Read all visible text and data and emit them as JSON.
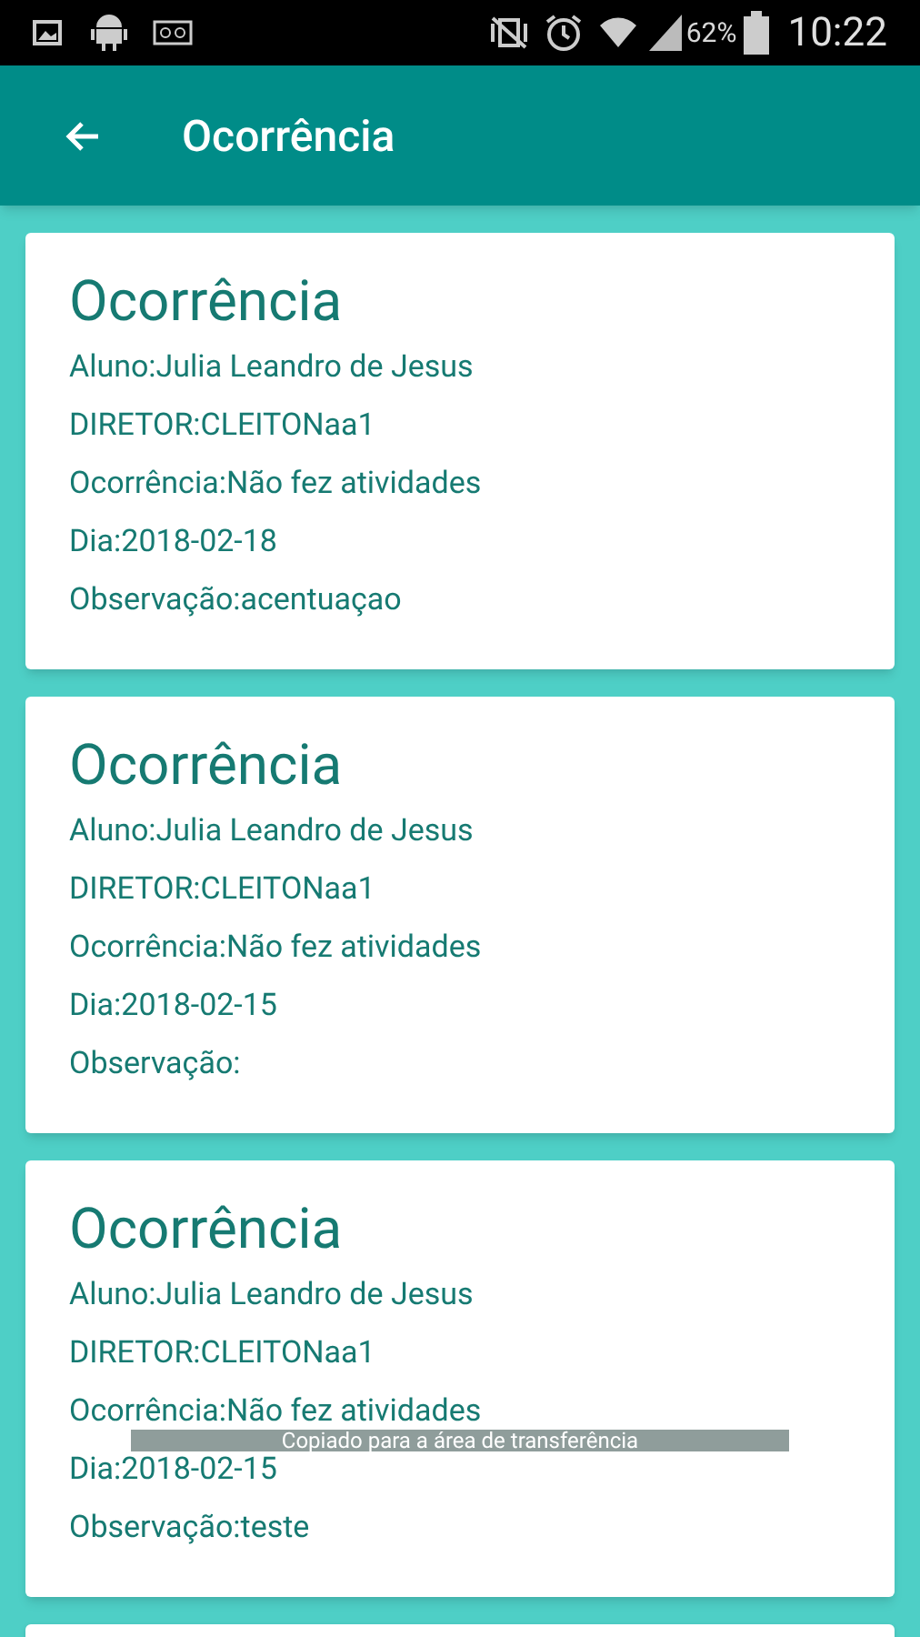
{
  "status_bar": {
    "battery": "62%",
    "time": "10:22"
  },
  "app_bar": {
    "title": "Ocorrência"
  },
  "cards": [
    {
      "title": "Ocorrência",
      "lines": [
        "Aluno:Julia Leandro de Jesus",
        "DIRETOR:CLEITONaa1",
        "Ocorrência:Não fez atividades",
        "Dia:2018-02-18",
        "Observação:acentuaçao"
      ]
    },
    {
      "title": "Ocorrência",
      "lines": [
        "Aluno:Julia Leandro de Jesus",
        "DIRETOR:CLEITONaa1",
        "Ocorrência:Não fez atividades",
        "Dia:2018-02-15",
        "Observação:"
      ]
    },
    {
      "title": "Ocorrência",
      "lines": [
        "Aluno:Julia Leandro de Jesus",
        "DIRETOR:CLEITONaa1",
        "Ocorrência:Não fez atividades",
        "Dia:2018-02-15",
        "Observação:teste"
      ]
    },
    {
      "kind": "partial"
    }
  ],
  "toast": "Copiado para a área de transferência"
}
